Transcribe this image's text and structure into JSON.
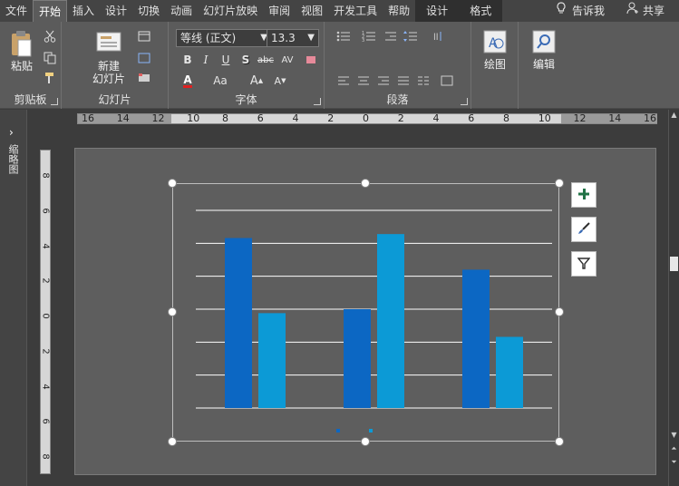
{
  "tabs": [
    {
      "label": "文件",
      "active": false,
      "contextual": false
    },
    {
      "label": "开始",
      "active": true,
      "contextual": false
    },
    {
      "label": "插入",
      "active": false,
      "contextual": false
    },
    {
      "label": "设计",
      "active": false,
      "contextual": false
    },
    {
      "label": "切换",
      "active": false,
      "contextual": false
    },
    {
      "label": "动画",
      "active": false,
      "contextual": false
    },
    {
      "label": "幻灯片放映",
      "active": false,
      "contextual": false
    },
    {
      "label": "审阅",
      "active": false,
      "contextual": false
    },
    {
      "label": "视图",
      "active": false,
      "contextual": false
    },
    {
      "label": "开发工具",
      "active": false,
      "contextual": false
    },
    {
      "label": "帮助",
      "active": false,
      "contextual": false
    },
    {
      "label": "设计",
      "active": false,
      "contextual": true
    },
    {
      "label": "格式",
      "active": false,
      "contextual": true
    }
  ],
  "tell_me": "告诉我",
  "share": "共享",
  "ribbon": {
    "clipboard": {
      "paste": "粘贴",
      "label": "剪贴板"
    },
    "slides": {
      "new_slide_line1": "新建",
      "new_slide_line2": "幻灯片",
      "label": "幻灯片"
    },
    "font": {
      "name": "等线 (正文)",
      "size": "13.3",
      "label": "字体",
      "aa": "Aa"
    },
    "paragraph": {
      "label": "段落"
    },
    "drawing": {
      "label": "绘图"
    },
    "editing": {
      "label": "编辑"
    }
  },
  "thumbnail_pane": {
    "label": "缩略图"
  },
  "ruler_h": [
    "16",
    "14",
    "12",
    "10",
    "8",
    "6",
    "4",
    "2",
    "0",
    "2",
    "4",
    "6",
    "8",
    "10",
    "12",
    "14",
    "16"
  ],
  "ruler_v": [
    "8",
    "6",
    "4",
    "2",
    "0",
    "2",
    "4",
    "6",
    "8"
  ],
  "colors": {
    "series1": "#0c67c3",
    "series2": "#0c9ad6",
    "gridline": "#ffffff"
  },
  "chart_data": {
    "type": "bar",
    "categories": [
      "",
      "",
      ""
    ],
    "series": [
      {
        "values": [
          4.3,
          2.5,
          3.5
        ]
      },
      {
        "values": [
          2.4,
          4.4,
          1.8
        ]
      }
    ],
    "ylim": [
      0,
      5
    ],
    "gridlines": 6,
    "grid": true,
    "title": "",
    "xlabel": "",
    "ylabel": ""
  }
}
